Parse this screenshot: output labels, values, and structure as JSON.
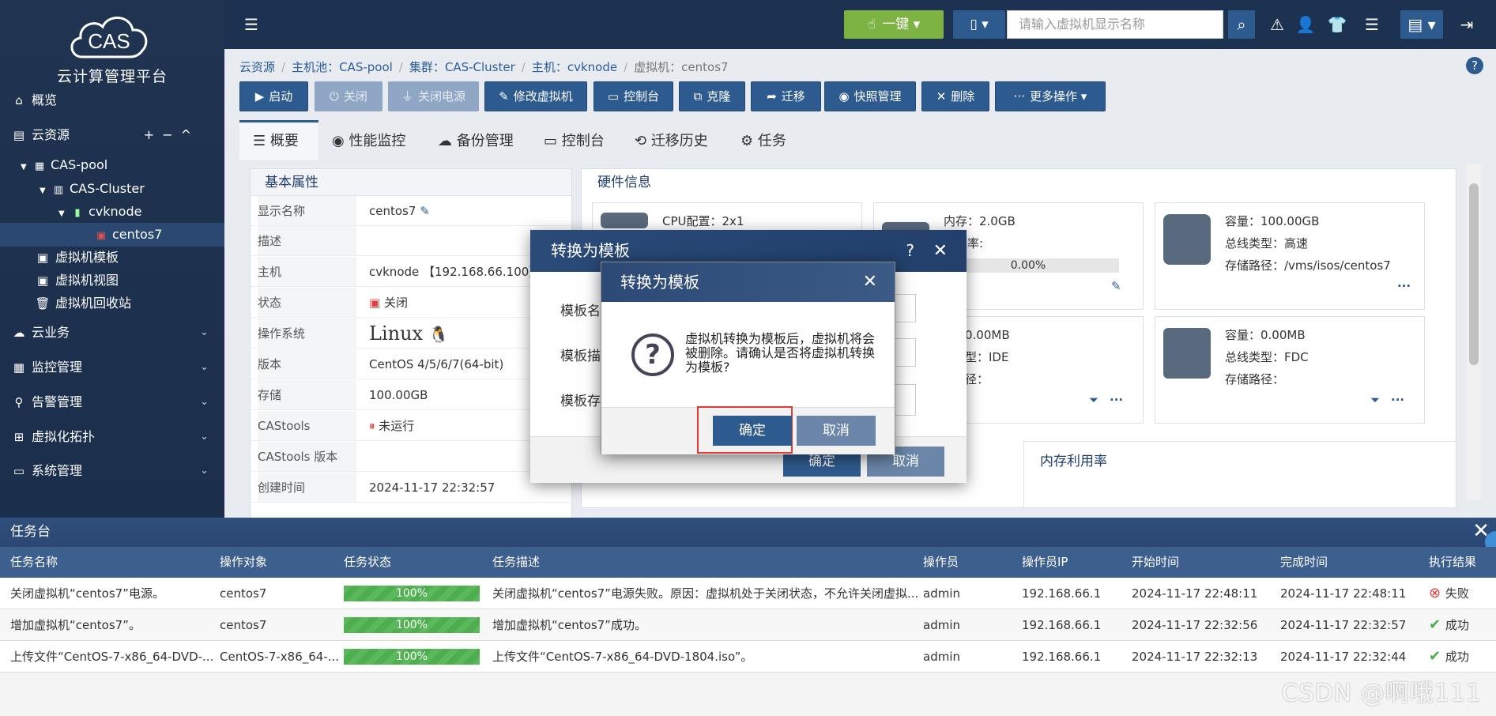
{
  "sidebar": {
    "logo_text": "CAS",
    "subtitle": "云计算管理平台",
    "items": [
      {
        "label": "概览",
        "icon": "home-icon"
      },
      {
        "label": "云资源",
        "icon": "cloud-resource-icon",
        "controls": [
          "+",
          "−",
          "^"
        ]
      },
      {
        "label": "虚拟机模板",
        "icon": "vm-template-icon"
      },
      {
        "label": "虚拟机视图",
        "icon": "vm-view-icon"
      },
      {
        "label": "虚拟机回收站",
        "icon": "trash-icon"
      },
      {
        "label": "云业务",
        "icon": "cloud-icon"
      },
      {
        "label": "监控管理",
        "icon": "monitor-icon"
      },
      {
        "label": "告警管理",
        "icon": "alarm-icon"
      },
      {
        "label": "虚拟化拓扑",
        "icon": "topology-icon"
      },
      {
        "label": "系统管理",
        "icon": "system-icon"
      }
    ],
    "tree": [
      {
        "label": "CAS-pool"
      },
      {
        "label": "CAS-Cluster"
      },
      {
        "label": "cvknode"
      },
      {
        "label": "centos7"
      }
    ]
  },
  "topbar": {
    "onekey_label": "一键",
    "search_placeholder": "请输入虚拟机显示名称"
  },
  "breadcrumb": {
    "items": [
      "云资源",
      "主机池：CAS-pool",
      "集群：CAS-Cluster",
      "主机：cvknode"
    ],
    "current": "虚拟机：centos7"
  },
  "actions": [
    {
      "label": "启动"
    },
    {
      "label": "关闭"
    },
    {
      "label": "关闭电源"
    },
    {
      "label": "修改虚拟机"
    },
    {
      "label": "控制台"
    },
    {
      "label": "克隆"
    },
    {
      "label": "迁移"
    },
    {
      "label": "快照管理"
    },
    {
      "label": "删除"
    },
    {
      "label": "更多操作"
    }
  ],
  "tabs": [
    {
      "label": "概要"
    },
    {
      "label": "性能监控"
    },
    {
      "label": "备份管理"
    },
    {
      "label": "控制台"
    },
    {
      "label": "迁移历史"
    },
    {
      "label": "任务"
    }
  ],
  "basic": {
    "title": "基本属性",
    "rows": [
      {
        "key": "显示名称",
        "value": "centos7"
      },
      {
        "key": "描述",
        "value": ""
      },
      {
        "key": "主机",
        "value": "cvknode 【192.168.66.100】"
      },
      {
        "key": "状态",
        "value": "关闭"
      },
      {
        "key": "操作系统",
        "value": "Linux"
      },
      {
        "key": "版本",
        "value": "CentOS 4/5/6/7(64-bit)"
      },
      {
        "key": "存储",
        "value": "100.00GB"
      },
      {
        "key": "CAStools",
        "value": "未运行"
      },
      {
        "key": "CAStools 版本",
        "value": ""
      },
      {
        "key": "创建时间",
        "value": "2024-11-17 22:32:57"
      }
    ]
  },
  "hardware": {
    "title": "硬件信息",
    "cpu": {
      "line1": "CPU配置：2x1"
    },
    "memory": {
      "line1": "内存：2.0GB",
      "line2": "利用率:",
      "usage": "0.00%",
      "usage_fraction": 0
    },
    "disk": {
      "line1": "容量：100.00GB",
      "line2": "总线类型：高速",
      "line3": "存储路径：/vms/isos/centos7"
    },
    "cdrom": {
      "line1": "：0.00MB",
      "line2": "类型：IDE",
      "line3": "路径："
    },
    "floppy": {
      "line1": "容量：0.00MB",
      "line2": "总线类型：FDC",
      "line3": "存储路径："
    },
    "more": "···"
  },
  "mem_chart_title": "内存利用率",
  "dialog_outer": {
    "title": "转换为模板",
    "help": "?",
    "close": "✕",
    "field1": "模板名",
    "field2": "模板描",
    "field3": "模板存",
    "ok": "确定",
    "cancel": "取消"
  },
  "dialog_confirm": {
    "title": "转换为模板",
    "close": "✕",
    "message": "虚拟机转换为模板后，虚拟机将会被删除。请确认是否将虚拟机转换为模板?",
    "ok": "确定",
    "cancel": "取消"
  },
  "console": {
    "title": "任务台",
    "close": "✕",
    "columns": [
      "任务名称",
      "操作对象",
      "任务状态",
      "任务描述",
      "操作员",
      "操作员IP",
      "开始时间",
      "完成时间",
      "执行结果"
    ],
    "rows": [
      {
        "name": "关闭虚拟机“centos7”电源。",
        "target": "centos7",
        "progress": "100%",
        "progress_fraction": 1.0,
        "desc": "关闭虚拟机“centos7”电源失败。原因：虚拟机处于关闭状态，不允许关闭虚拟...",
        "operator": "admin",
        "ip": "192.168.66.1",
        "start": "2024-11-17 22:48:11",
        "end": "2024-11-17 22:48:11",
        "result": "失败",
        "result_color": "#e04040"
      },
      {
        "name": "增加虚拟机“centos7”。",
        "target": "centos7",
        "progress": "100%",
        "progress_fraction": 1.0,
        "desc": "增加虚拟机“centos7”成功。",
        "operator": "admin",
        "ip": "192.168.66.1",
        "start": "2024-11-17 22:32:56",
        "end": "2024-11-17 22:32:57",
        "result": "成功",
        "result_color": "#4cae4c"
      },
      {
        "name": "上传文件“CentOS-7-x86_64-DVD-...",
        "target": "CentOS-7-x86_64-...",
        "progress": "100%",
        "progress_fraction": 1.0,
        "desc": "上传文件“CentOS-7-x86_64-DVD-1804.iso”。",
        "operator": "admin",
        "ip": "192.168.66.1",
        "start": "2024-11-17 22:32:13",
        "end": "2024-11-17 22:32:44",
        "result": "成功",
        "result_color": "#4cae4c"
      }
    ]
  },
  "watermark": "CSDN @啊哦111",
  "colors": {
    "primary": "#2e5b8f",
    "nav_bg": "#1d3150",
    "onekey": "#7cb342",
    "success": "#4cae4c",
    "fail": "#e04040",
    "highlight": "#e53935"
  }
}
